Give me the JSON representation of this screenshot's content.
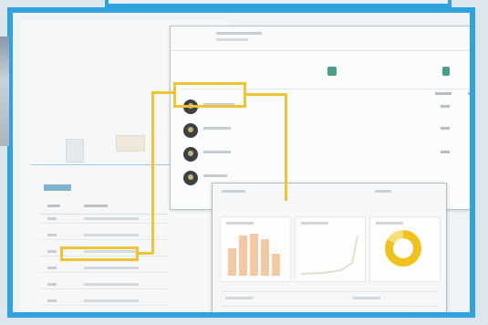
{
  "screen": {
    "frame_color": "#2fa3e0",
    "highlight_color": "#f1c232",
    "accent_green": "#4a9d8d"
  },
  "panels": {
    "back_list": {
      "row_count": 9
    },
    "middle_table": {
      "avatar_rows": 4,
      "metric_columns": 2
    },
    "front_charts": {
      "cards": [
        "bar-chart",
        "line-chart",
        "donut-chart"
      ],
      "donut_fill": 0.83
    }
  },
  "icons": [
    "document-icon",
    "avatar-icon",
    "donut-chart-icon"
  ]
}
